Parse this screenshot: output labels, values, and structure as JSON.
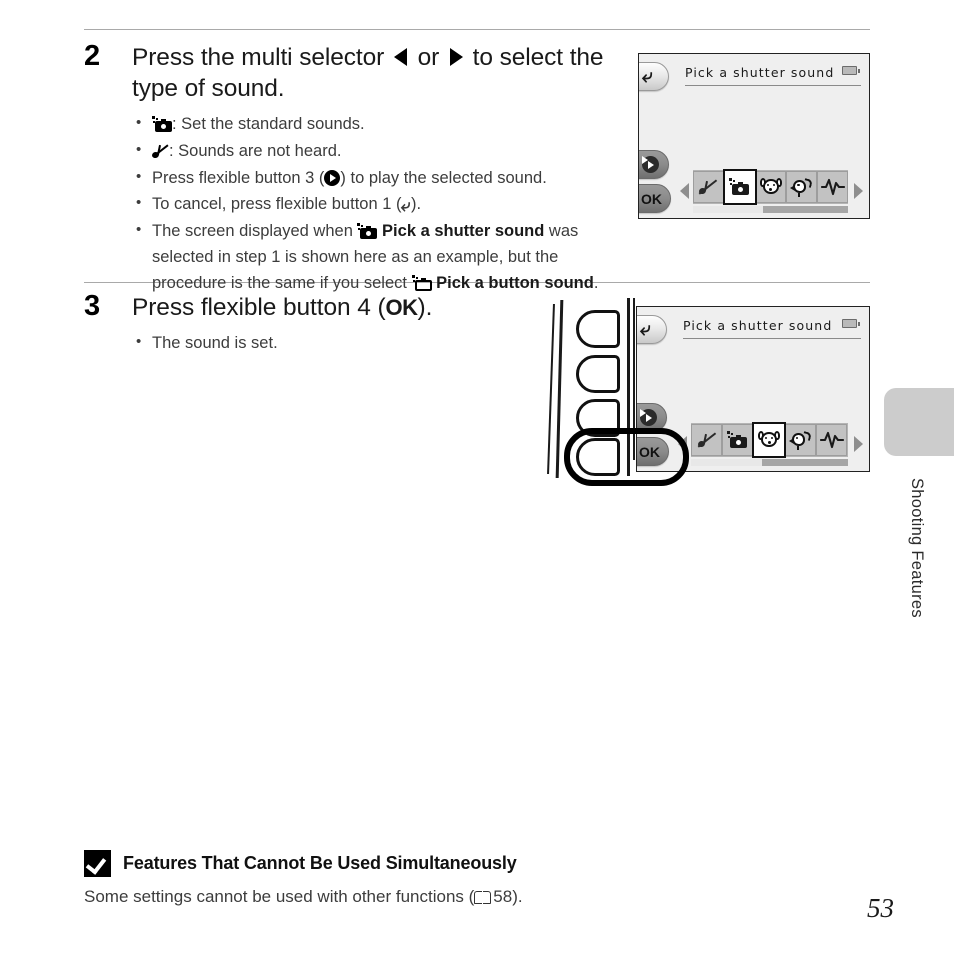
{
  "page": {
    "number": "53",
    "side_tab_label": "Shooting Features"
  },
  "steps": [
    {
      "number": "2",
      "title_parts": {
        "before": "Press the multi selector ",
        "mid": " or ",
        "after": " to select the type of sound."
      },
      "bullets": [
        {
          "icon": "camera-sound-icon",
          "text": ": Set the standard sounds."
        },
        {
          "icon": "mute-icon",
          "text": ": Sounds are not heard."
        },
        {
          "icon": null,
          "text_before": "Press flexible button 3 (",
          "inline_icon": "play-icon",
          "text_after": ") to play the selected sound."
        },
        {
          "icon": null,
          "text_before": "To cancel, press flexible button 1 (",
          "inline_icon": "back-icon",
          "text_after": ")."
        },
        {
          "icon": null,
          "text_before": "The screen displayed when ",
          "bold1": "Pick a shutter sound",
          "text_mid": " was selected in step 1 is shown here as an example, but the procedure is the same if you select ",
          "bold2": "Pick a button sound",
          "text_after": "."
        }
      ]
    },
    {
      "number": "3",
      "title_before": "Press flexible button 4 (",
      "title_ok": "OK",
      "title_after": ").",
      "bullets": [
        {
          "text": "The sound is set."
        }
      ]
    }
  ],
  "screens": [
    {
      "id": "screen-step2",
      "title": "Pick a shutter sound",
      "battery_icon": "battery-icon",
      "buttons": [
        {
          "name": "back-button",
          "label": "back-icon"
        },
        {
          "name": "play-button",
          "label": "play-icon"
        },
        {
          "name": "ok-button",
          "label": "OK"
        }
      ],
      "icon_strip": [
        {
          "name": "sound-off-icon",
          "selected": false
        },
        {
          "name": "standard-camera-sound-icon",
          "selected": true
        },
        {
          "name": "dog-sound-icon",
          "selected": false
        },
        {
          "name": "bird-sound-icon",
          "selected": false
        },
        {
          "name": "waveform-sound-icon",
          "selected": false
        }
      ],
      "scroll_thumb_percent": 45
    },
    {
      "id": "screen-step3",
      "title": "Pick a shutter sound",
      "battery_icon": "battery-icon",
      "buttons": [
        {
          "name": "back-button",
          "label": "back-icon"
        },
        {
          "name": "play-button",
          "label": "play-icon"
        },
        {
          "name": "ok-button",
          "label": "OK"
        }
      ],
      "icon_strip": [
        {
          "name": "sound-off-icon",
          "selected": false
        },
        {
          "name": "standard-camera-sound-icon",
          "selected": false
        },
        {
          "name": "dog-sound-icon",
          "selected": true
        },
        {
          "name": "bird-sound-icon",
          "selected": false
        },
        {
          "name": "waveform-sound-icon",
          "selected": false
        }
      ],
      "scroll_thumb_percent": 45
    }
  ],
  "camera_body": {
    "flexible_buttons": [
      "flexible-button-1",
      "flexible-button-2",
      "flexible-button-3",
      "flexible-button-4"
    ],
    "highlighted_button": "flexible-button-4",
    "highlighted_label": "OK"
  },
  "note": {
    "icon": "caution-check-icon",
    "title": "Features That Cannot Be Used Simultaneously",
    "text_before": "Some settings cannot be used with other functions (",
    "reference_icon": "book-icon",
    "reference_page": "58",
    "text_after": ")."
  },
  "colors": {
    "rule": "#a9a9a9",
    "screen_bg": "#efefef",
    "strip_bg": "#b4b4b4",
    "cell_bg": "#c2c2c2",
    "side_tab": "#cccccc",
    "text": "#3c3c3c"
  }
}
